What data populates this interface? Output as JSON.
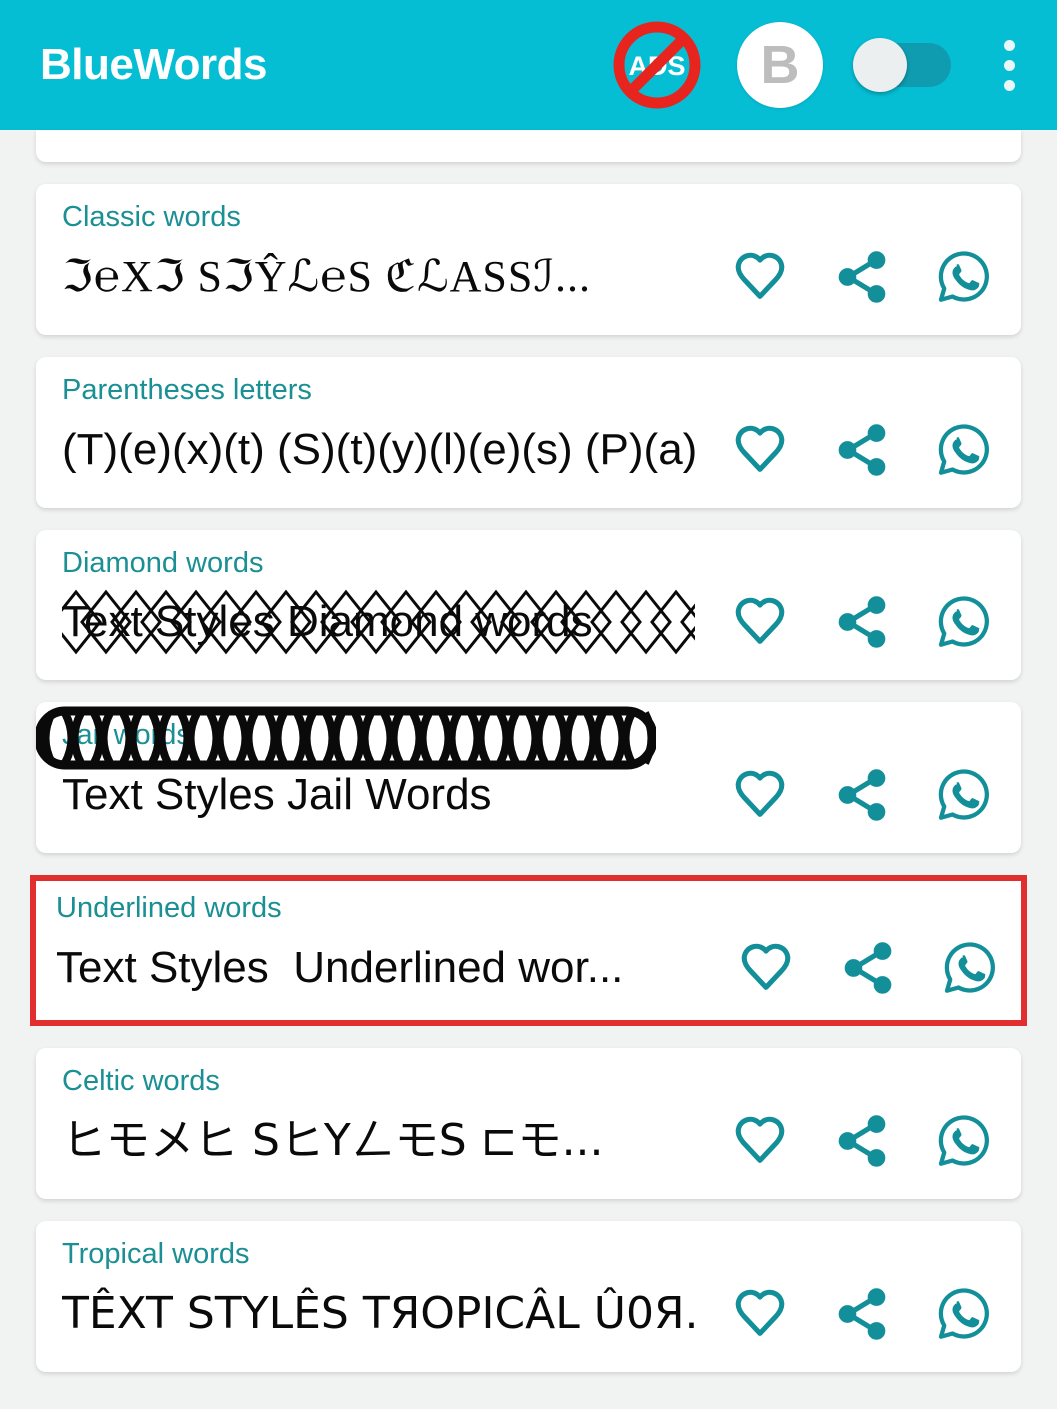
{
  "header": {
    "title": "BlueWords",
    "no_ads_icon_label": "ADS",
    "avatar_letter": "B",
    "toggle_state": "off",
    "overflow_label": "More options",
    "background_color": "#06bed4"
  },
  "theme": {
    "accent": "#06bed4",
    "label_teal": "#1a8f94",
    "icon_teal": "#128f99",
    "selection_red": "#e12f2f",
    "page_background": "#f1f2f2",
    "card_background": "#ffffff"
  },
  "actions": {
    "favorite": "favorite",
    "share": "share",
    "whatsapp": "whatsapp"
  },
  "list": {
    "items": [
      {
        "label": "Classic words",
        "sample": "ℑ℮Xℑ SℑŶℒ℮S  ℭℒΑSSℐ...",
        "style": "serif",
        "selected": false
      },
      {
        "label": "Parentheses letters",
        "sample": "(T)(e)(x)(t) (S)(t)(y)(l)(e)(s)  (P)(a)...",
        "style": "sans",
        "selected": false
      },
      {
        "label": "Diamond words",
        "sample": "Text Styles  Diamond words",
        "style": "diamond",
        "selected": false
      },
      {
        "label": "Jail words",
        "sample": "Text Styles  Jail Words",
        "style": "jail",
        "selected": false
      },
      {
        "label": "Underlined words",
        "sample": "Text Styles  Underlined wor...",
        "style": "underlined",
        "selected": true
      },
      {
        "label": "Celtic words",
        "sample": "ヒモメヒ SヒYㄥモS ⊏モ...",
        "style": "celtic",
        "selected": false
      },
      {
        "label": "Tropical words",
        "sample": "TÊXT STYLÊS  TЯOPICÂL Û0Я...",
        "style": "tropical",
        "selected": false
      }
    ]
  }
}
